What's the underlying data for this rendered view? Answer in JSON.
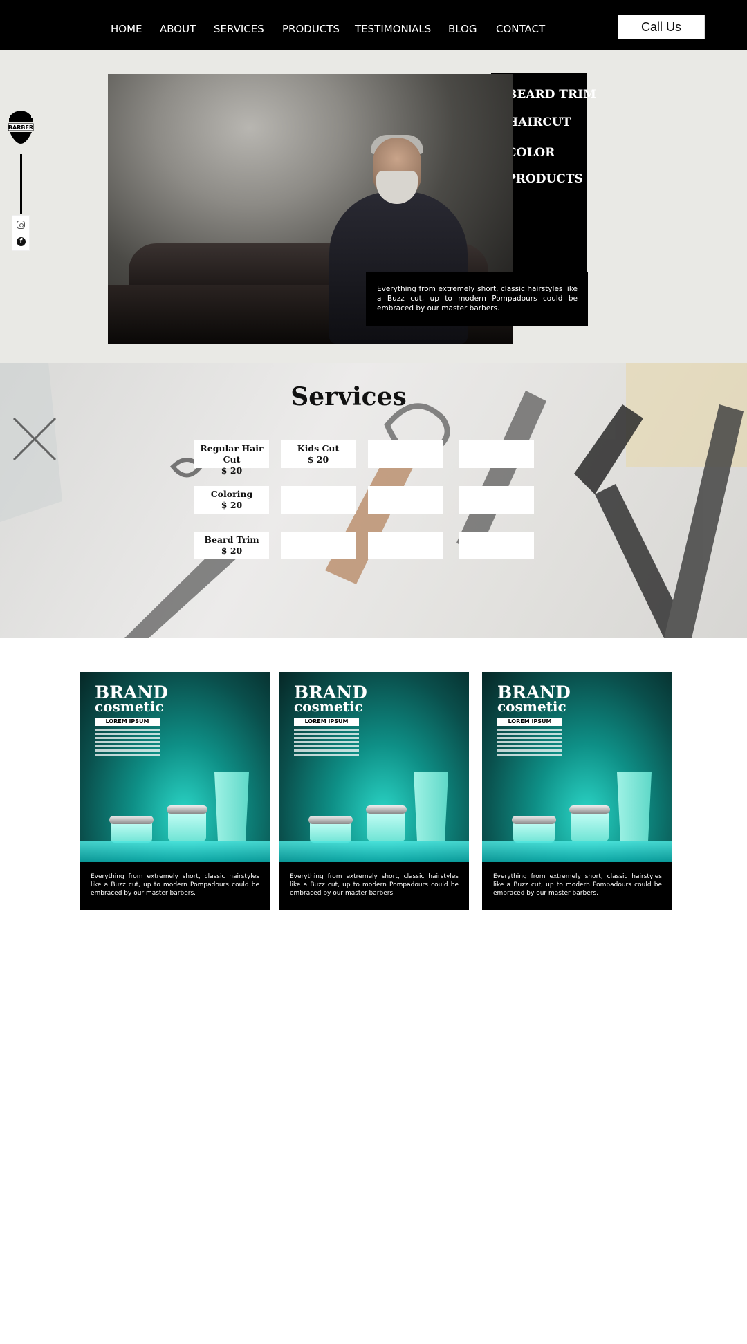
{
  "nav": {
    "items": [
      "HOME",
      "ABOUT",
      "SERVICES",
      "PRODUCTS",
      "TESTIMONIALS",
      "BLOG",
      "CONTACT"
    ],
    "call_label": "Call Us"
  },
  "logo": {
    "line1": "BARBER"
  },
  "hero": {
    "menu": [
      "BEARD TRIM",
      "HAIRCUT",
      "COLOR",
      "PRODUCTS"
    ],
    "caption": "Everything from extremely short, classic hairstyles like a Buzz cut, up to modern Pompadours could be embraced by our master barbers."
  },
  "social": {
    "facebook_glyph": "f"
  },
  "services": {
    "title": "Services",
    "rows": [
      [
        {
          "name": "Regular Hair Cut",
          "price": "$ 20"
        },
        {
          "name": "Kids Cut",
          "price": "$ 20"
        },
        {
          "name": "",
          "price": ""
        },
        {
          "name": "",
          "price": ""
        }
      ],
      [
        {
          "name": "Coloring",
          "price": "$ 20"
        },
        {
          "name": "",
          "price": ""
        },
        {
          "name": "",
          "price": ""
        },
        {
          "name": "",
          "price": ""
        }
      ],
      [
        {
          "name": "Beard Trim",
          "price": "$ 20"
        },
        {
          "name": "",
          "price": ""
        },
        {
          "name": "",
          "price": ""
        },
        {
          "name": "",
          "price": ""
        }
      ]
    ]
  },
  "products": [
    {
      "brand": "BRAND",
      "sub": "cosmetic",
      "bar": "LOREM IPSUM",
      "text": "Everything from extremely short, classic hairstyles like a Buzz cut, up to modern Pompadours could be embraced by our master barbers."
    },
    {
      "brand": "BRAND",
      "sub": "cosmetic",
      "bar": "LOREM IPSUM",
      "text": "Everything from extremely short, classic hairstyles like a Buzz cut, up to modern Pompadours could be embraced by our master barbers."
    },
    {
      "brand": "BRAND",
      "sub": "cosmetic",
      "bar": "LOREM IPSUM",
      "text": "Everything from extremely short, classic hairstyles like a Buzz cut, up to modern Pompadours could be embraced by our master barbers."
    }
  ],
  "colors": {
    "header": "#000000",
    "hero_band": "#e9e9e5",
    "accent_teal": "#0e8f86"
  }
}
